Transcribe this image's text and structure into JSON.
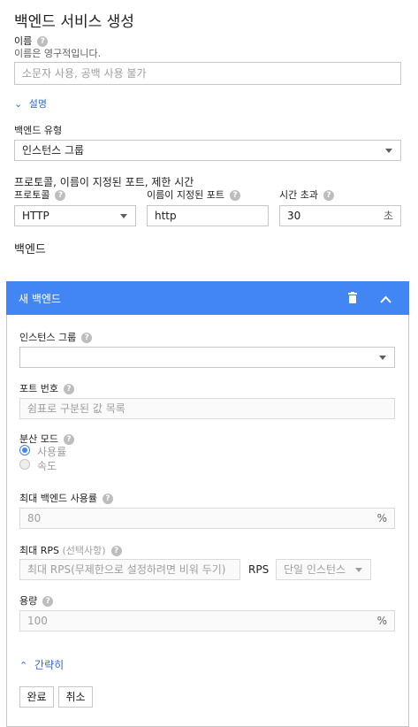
{
  "title": "백엔드 서비스 생성",
  "name": {
    "label": "이름",
    "note": "이름은 영구적입니다.",
    "placeholder": "소문자 사용, 공백 사용 불가"
  },
  "description_toggle": "설명",
  "backend_type": {
    "label": "백엔드 유형",
    "value": "인스턴스 그룹"
  },
  "protocol_section": {
    "heading": "프로토콜, 이름이 지정된 포트, 제한 시간",
    "protocol_label": "프로토콜",
    "protocol_value": "HTTP",
    "port_label": "이름이 지정된 포트",
    "port_value": "http",
    "timeout_label": "시간 초과",
    "timeout_value": "30",
    "timeout_unit": "초"
  },
  "backends_heading": "백엔드",
  "new_backend": {
    "header_title": "새 백엔드",
    "instance_group_label": "인스턴스 그룹",
    "instance_group_value": "",
    "port_numbers_label": "포트 번호",
    "port_numbers_placeholder": "쉼표로 구분된 값 목록",
    "balancing_mode_label": "분산 모드",
    "balancing_options": [
      {
        "label": "사용률",
        "selected": true
      },
      {
        "label": "속도",
        "selected": false
      }
    ],
    "max_utilization_label": "최대 백엔드 사용률",
    "max_utilization_value": "80",
    "percent_unit": "%",
    "max_rps_label": "최대 RPS",
    "max_rps_optional": "(선택사항)",
    "max_rps_placeholder": "최대 RPS(무제한으로 설정하려면 비워 두기)",
    "rps_unit": "RPS",
    "rps_scope": "단일 인스턴스",
    "capacity_label": "용량",
    "capacity_value": "100",
    "collapse_link": "간략히",
    "done_button": "완료",
    "cancel_button": "취소"
  },
  "colors": {
    "accent": "#4285f4",
    "link": "#3367d6"
  }
}
